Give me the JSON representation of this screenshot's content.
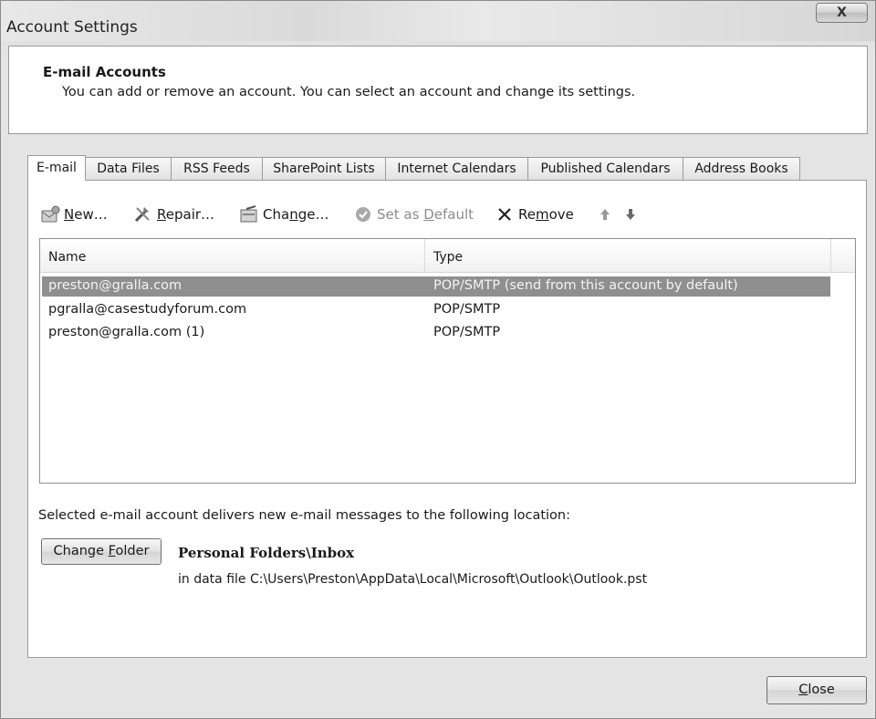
{
  "window": {
    "title": "Account Settings",
    "close_glyph": "X"
  },
  "header": {
    "title": "E-mail Accounts",
    "description": "You can add or remove an account. You can select an account and change its settings."
  },
  "tabs": [
    {
      "label": "E-mail"
    },
    {
      "label": "Data Files"
    },
    {
      "label": "RSS Feeds"
    },
    {
      "label": "SharePoint Lists"
    },
    {
      "label": "Internet Calendars"
    },
    {
      "label": "Published Calendars"
    },
    {
      "label": "Address Books"
    }
  ],
  "toolbar": {
    "new": {
      "u": "N",
      "rest": "ew…",
      "icon": "new-account-icon"
    },
    "repair": {
      "u": "R",
      "rest": "epair…",
      "icon": "repair-icon"
    },
    "change": {
      "pre": "Cha",
      "u": "n",
      "rest": "ge…",
      "icon": "change-icon"
    },
    "set_default": {
      "pre": "Set as ",
      "u": "D",
      "rest": "efault",
      "icon": "checkmark-icon"
    },
    "remove": {
      "pre": "Re",
      "u": "m",
      "rest": "ove",
      "icon": "remove-x-icon"
    },
    "move_up_icon": "arrow-up-icon",
    "move_down_icon": "arrow-down-icon"
  },
  "accounts_list": {
    "columns": {
      "name": "Name",
      "type": "Type"
    },
    "rows": [
      {
        "name": "preston@gralla.com",
        "type": "POP/SMTP (send from this account by default)",
        "selected": true
      },
      {
        "name": "pgralla@casestudyforum.com",
        "type": "POP/SMTP",
        "selected": false
      },
      {
        "name": "preston@gralla.com (1)",
        "type": "POP/SMTP",
        "selected": false
      }
    ]
  },
  "delivery": {
    "label": "Selected e-mail account delivers new e-mail messages to the following location:",
    "change_folder": {
      "pre": "Change ",
      "u": "F",
      "rest": "older"
    },
    "folder": "Personal Folders\\Inbox",
    "data_file": "in data file C:\\Users\\Preston\\AppData\\Local\\Microsoft\\Outlook\\Outlook.pst"
  },
  "footer": {
    "close": {
      "u": "C",
      "rest": "lose"
    }
  },
  "colors": {
    "selection": "#8f8f8f",
    "panel_border": "#9a9a9a",
    "background": "#e6e6e6"
  }
}
